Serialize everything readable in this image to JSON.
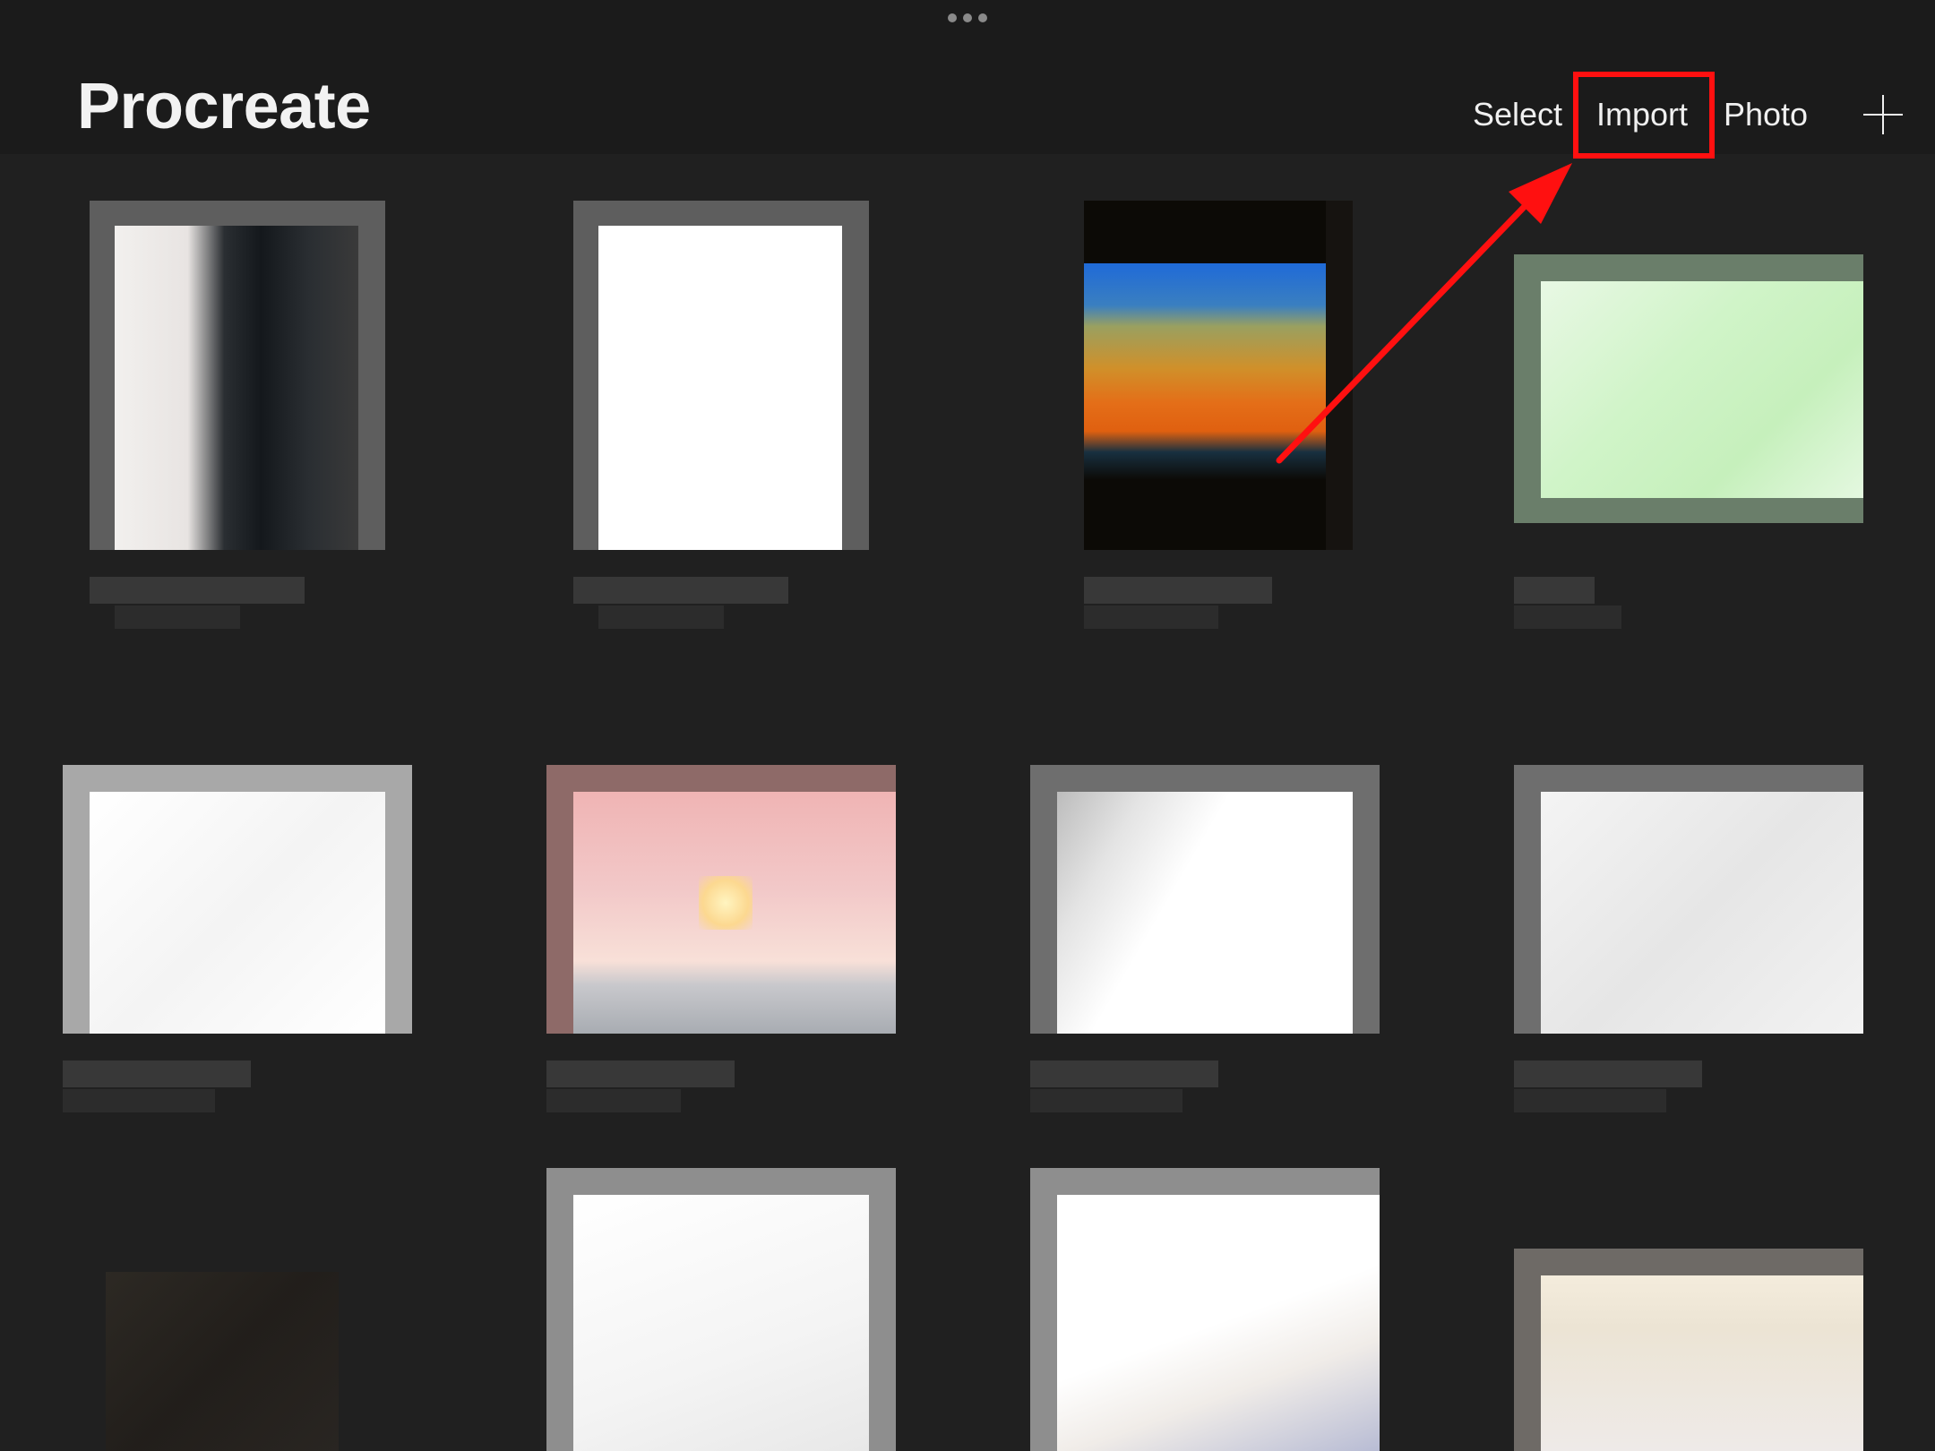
{
  "app": {
    "title": "Procreate"
  },
  "toolbar": {
    "select_label": "Select",
    "import_label": "Import",
    "photo_label": "Photo",
    "new_icon": "plus-icon"
  },
  "annotation": {
    "color": "#ff1010",
    "target": "Import"
  },
  "colors": {
    "background": "#202020",
    "topbar": "#1b1b1b",
    "text": "#f0f0f0"
  }
}
